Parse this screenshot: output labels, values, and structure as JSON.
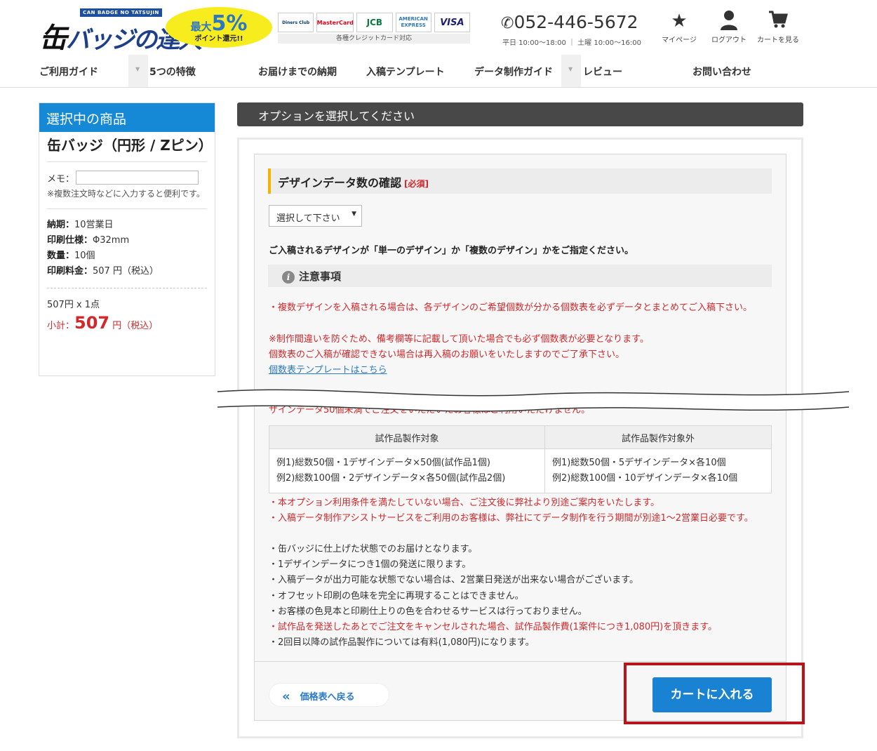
{
  "header": {
    "logo_tag": "CAN BADGE NO TATSUJIN",
    "logo_kan": "缶",
    "logo_text": "バッジの達人",
    "promo_prefix": "最大",
    "promo_big": "5%",
    "promo_sub": "ポイント還元!!",
    "cards": [
      "Diners Club",
      "MasterCard",
      "JCB",
      "AMERICAN EXPRESS",
      "VISA"
    ],
    "cards_caption": "各種クレジットカード対応",
    "phone": "052-446-5672",
    "hours": "平日 10:00〜18:00 ｜ 土曜 10:00〜16:00",
    "icons": [
      {
        "label": "マイページ",
        "icon": "star-icon"
      },
      {
        "label": "ログアウト",
        "icon": "user-icon"
      },
      {
        "label": "カートを見る",
        "icon": "cart-icon"
      }
    ]
  },
  "nav": [
    "ご利用ガイド",
    "5つの特徴",
    "お届けまでの納期",
    "入稿テンプレート",
    "データ制作ガイド",
    "レビュー",
    "お問い合わせ"
  ],
  "sidebar": {
    "title": "選択中の商品",
    "product": "缶バッジ（円形 / Zピン）",
    "memo_label": "メモ：",
    "memo_value": "",
    "memo_note": "※複数注文時などに入力すると便利です。",
    "specs": [
      {
        "k": "納期：",
        "v": "10営業日"
      },
      {
        "k": "印刷仕様：",
        "v": "Φ32mm"
      },
      {
        "k": "数量：",
        "v": "10個"
      },
      {
        "k": "印刷料金：",
        "v": "507 円（税込）"
      }
    ],
    "qty_line": "507円 x 1点",
    "subtotal_label": "小計：",
    "subtotal_amount": "507",
    "subtotal_unit": "円（税込）"
  },
  "main": {
    "header": "オプションを選択してください",
    "section_title": "デザインデータ数の確認",
    "required": "[必須]",
    "select_value": "選択して下さい",
    "description": "ご入稿されるデザインが「単一のデザイン」か「複数のデザイン」かをご指定ください。",
    "notice_title": "注意事項",
    "red_lines": [
      "・複数デザインを入稿される場合は、各デザインのご希望個数が分かる個数表を必ずデータとまとめてご入稿下さい。",
      "※制作間違いを防ぐため、備考欄等に記載して頂いた場合でも必ず個数表が必要となります。",
      "個数表のご入稿が確認できない場合は再入稿のお願いをいたしますのでご了承下さい。"
    ],
    "template_link": "個数表テンプレートはこちら",
    "partial_line": "ザインデータ50個未満でご注文をいただいたお客様はご利用いただけません。",
    "table": {
      "headers": [
        "試作品製作対象",
        "試作品製作対象外"
      ],
      "left": [
        "例1)総数50個・1デザインデータ×50個(試作品1個)",
        "例2)総数100個・2デザインデータ×各50個(試作品2個)"
      ],
      "right": [
        "例1)総数50個・5デザインデータ×各10個",
        "例2)総数100個・10デザインデータ×各10個"
      ]
    },
    "notes": [
      {
        "red": true,
        "text": "・本オプション利用条件を満たしていない場合、ご注文後に弊社より別途ご案内をいたします。"
      },
      {
        "red": true,
        "text": "・入稿データ制作アシストサービスをご利用のお客様は、弊社にてデータ制作を行う期間が別途1〜2営業日必要です。"
      },
      {
        "red": false,
        "text": "・缶バッジに仕上げた状態でのお届けとなります。"
      },
      {
        "red": false,
        "text": "・1デザインデータにつき1個の発送に限ります。"
      },
      {
        "red": false,
        "text": "・入稿データが出力可能な状態でない場合は、2営業日発送が出来ない場合がございます。"
      },
      {
        "red": false,
        "text": "・オフセット印刷の色味を完全に再現することはできません。"
      },
      {
        "red": false,
        "text": "・お客様の色見本と印刷仕上りの色を合わせるサービスは行っておりません。"
      },
      {
        "red": true,
        "text": "・試作品を発送したあとでご注文をキャンセルされた場合、試作品製作費(1案件につき1,080円)を頂きます。"
      },
      {
        "red": false,
        "text": "・2回目以降の試作品製作については有料(1,080円)になります。"
      }
    ],
    "back_button": "価格表へ戻る",
    "cart_button": "カートに入れる"
  },
  "colors": {
    "accent": "#1a82d2",
    "required_red": "#d2282b",
    "highlight": "#b5151b",
    "section_bar": "#f3b400"
  }
}
